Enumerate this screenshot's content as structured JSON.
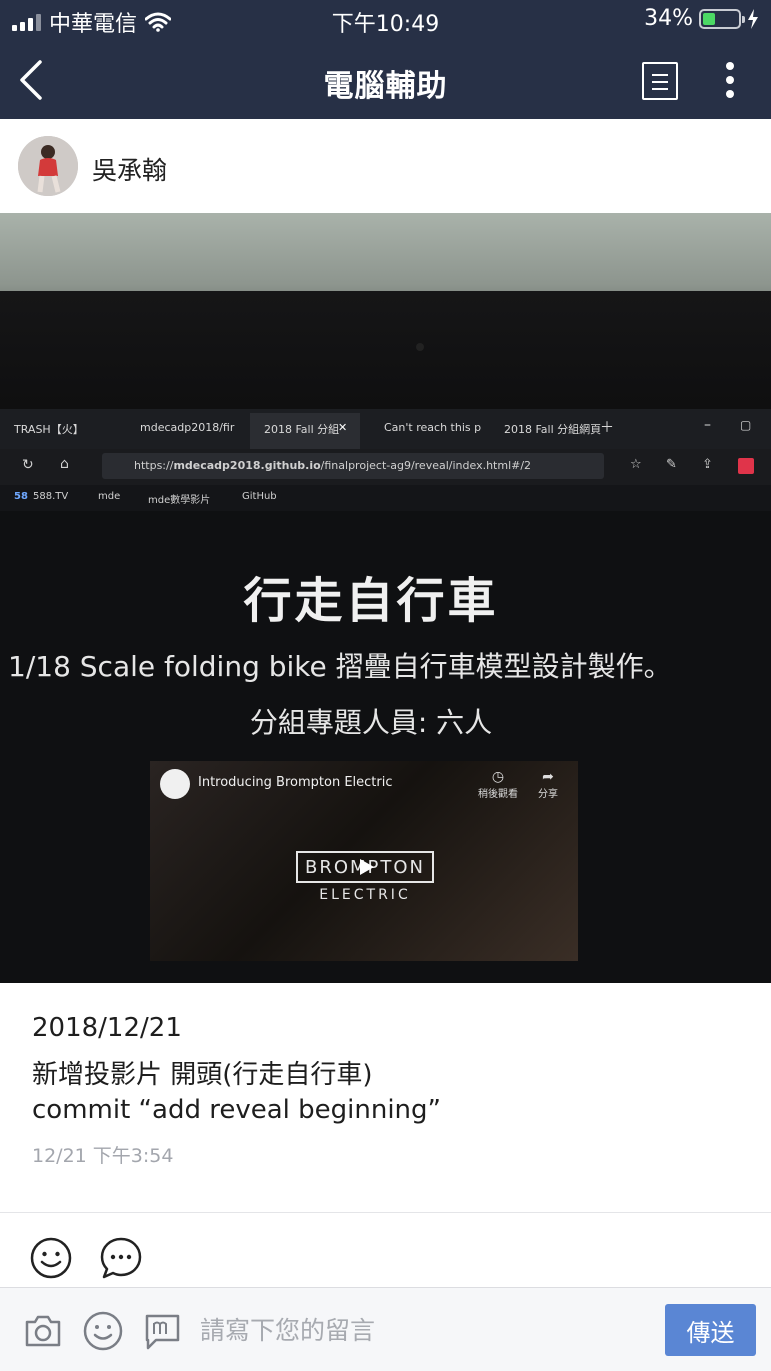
{
  "status_bar": {
    "carrier": "中華電信",
    "time": "下午10:49",
    "battery": "34%",
    "battery_level": 0.34
  },
  "nav": {
    "title": "電腦輔助"
  },
  "author": {
    "name": "吳承翰"
  },
  "photo": {
    "browser_tabs": [
      "TRASH【火】",
      "mdecadp2018/fir",
      "2018 Fall 分組",
      "Can't reach this p",
      "2018 Fall 分組網頁"
    ],
    "url_prefix": "https://",
    "url_host": "mdecadp2018.github.io",
    "url_path": "/finalproject-ag9/reveal/index.html#/2",
    "bookmarks": [
      "588.TV",
      "mde",
      "mde數學影片",
      "GitHub"
    ],
    "bookmark_badge": "58",
    "slide_title": "行走自行車",
    "slide_line1": "1/18 Scale folding bike 摺疊自行車模型設計製作。",
    "slide_line2": "分組專題人員: 六人",
    "video_title": "Introducing Brompton Electric",
    "video_watch_later": "稍後觀看",
    "video_share": "分享",
    "video_brand": "BROMPTON",
    "video_brand_sub": "ELECTRIC"
  },
  "post": {
    "lines": [
      "2018/12/21",
      "新增投影片 開頭(行走自行車)",
      "commit “add reveal beginning”"
    ],
    "timestamp": "12/21 下午3:54"
  },
  "comment": {
    "placeholder": "請寫下您的留言",
    "send_label": "傳送"
  },
  "colors": {
    "header_bg": "#273046",
    "send_button": "#5a86d4",
    "timestamp": "#a3a6ad"
  },
  "icons": {
    "nav_left": "back-chevron-icon",
    "nav_right": [
      "list-icon",
      "more-vertical-icon"
    ],
    "reactions": [
      "smiley-icon",
      "comment-bubble-icon"
    ],
    "comment_bar": [
      "camera-icon",
      "sticker-icon",
      "note-icon"
    ]
  }
}
